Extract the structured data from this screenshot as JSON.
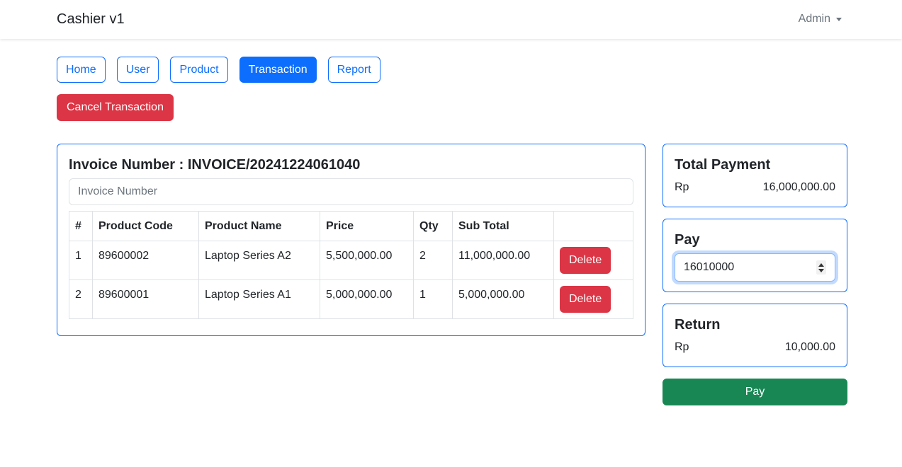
{
  "navbar": {
    "brand": "Cashier v1",
    "user_menu": "Admin"
  },
  "nav": {
    "buttons": [
      {
        "label": "Home",
        "active": false
      },
      {
        "label": "User",
        "active": false
      },
      {
        "label": "Product",
        "active": false
      },
      {
        "label": "Transaction",
        "active": true
      },
      {
        "label": "Report",
        "active": false
      }
    ]
  },
  "actions": {
    "cancel_label": "Cancel Transaction"
  },
  "invoice": {
    "title": "Invoice Number : INVOICE/20241224061040",
    "input_placeholder": "Invoice Number",
    "input_value": "",
    "columns": [
      "#",
      "Product Code",
      "Product Name",
      "Price",
      "Qty",
      "Sub Total",
      ""
    ],
    "rows": [
      {
        "idx": "1",
        "code": "89600002",
        "name": "Laptop Series A2",
        "price": "5,500,000.00",
        "qty": "2",
        "subtotal": "11,000,000.00",
        "action": "Delete"
      },
      {
        "idx": "2",
        "code": "89600001",
        "name": "Laptop Series A1",
        "price": "5,000,000.00",
        "qty": "1",
        "subtotal": "5,000,000.00",
        "action": "Delete"
      }
    ]
  },
  "total_payment": {
    "title": "Total Payment",
    "currency": "Rp",
    "amount": "16,000,000.00"
  },
  "pay": {
    "title": "Pay",
    "value": "16010000"
  },
  "return": {
    "title": "Return",
    "currency": "Rp",
    "amount": "10,000.00"
  },
  "pay_button": {
    "label": "Pay"
  },
  "colors": {
    "primary": "#0d6efd",
    "danger": "#dc3545",
    "success": "#198754",
    "muted": "#6c757d"
  }
}
